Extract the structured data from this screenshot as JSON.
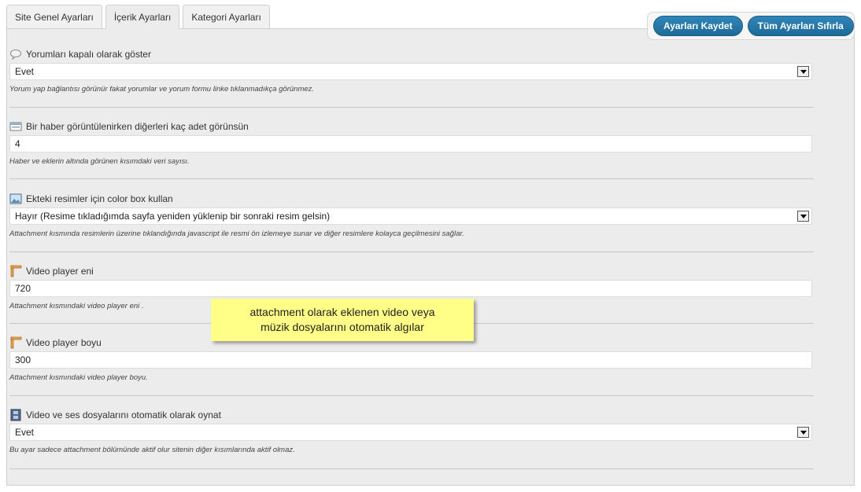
{
  "tabs": [
    {
      "label": "Site Genel Ayarları"
    },
    {
      "label": "İçerik Ayarları"
    },
    {
      "label": "Kategori Ayarları"
    }
  ],
  "buttons": {
    "save": "Ayarları Kaydet",
    "reset": "Tüm Ayarları Sıfırla"
  },
  "fields": [
    {
      "icon": "comment-icon",
      "label": "Yorumları kapalı olarak göster",
      "type": "select",
      "value": "Evet",
      "description": "Yorum yap bağlantısı görünür fakat yorumlar ve yorum formu linke tıklanmadıkça görünmez."
    },
    {
      "icon": "window-icon",
      "label": "Bir haber görüntülenirken diğerleri kaç adet görünsün",
      "type": "text",
      "value": "4",
      "description": "Haber ve eklerin altında görünen kısımdaki veri sayısı."
    },
    {
      "icon": "image-icon",
      "label": "Ekteki resimler için color box kullan",
      "type": "select",
      "value": "Hayır (Resime tıkladığımda sayfa yeniden yüklenip bir sonraki resim gelsin)",
      "description": "Attachment kısmında resimlerin üzerine tıklandığında javascript ile resmi ön izlemeye sunar ve diğer resimlere kolayca geçilmesini sağlar."
    },
    {
      "icon": "ruler-icon",
      "label": "Video player eni",
      "type": "text",
      "value": "720",
      "description": "Attachment kısmındaki video player eni ."
    },
    {
      "icon": "ruler-icon",
      "label": "Video player boyu",
      "type": "text",
      "value": "300",
      "description": "Attachment kısmındaki video player boyu."
    },
    {
      "icon": "film-icon",
      "label": "Video ve ses dosyalarını otomatik olarak oynat",
      "type": "select",
      "value": "Evet",
      "description": "Bu ayar sadece attachment bölümünde aktif olur sitenin diğer kısımlarında aktif olmaz."
    }
  ],
  "note": {
    "line1": "attachment olarak eklenen video veya",
    "line2": "müzik dosyalarını otomatik algılar"
  },
  "colors": {
    "button": "#1e6a98",
    "panel": "#ececec",
    "note": "#ffff88"
  }
}
